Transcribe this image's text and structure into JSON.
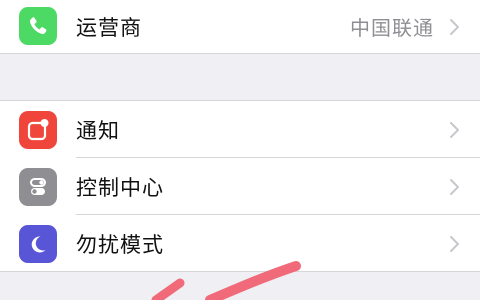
{
  "carrier_row": {
    "label": "运营商",
    "value": "中国联通",
    "icon": "phone-icon",
    "icon_color": "#4cd964"
  },
  "settings_rows": [
    {
      "label": "通知",
      "icon": "notifications-icon",
      "icon_color": "#f0453a"
    },
    {
      "label": "控制中心",
      "icon": "control-center-icon",
      "icon_color": "#8e8e93"
    },
    {
      "label": "勿扰模式",
      "icon": "do-not-disturb-moon-icon",
      "icon_color": "#5856d6"
    }
  ],
  "colors": {
    "background": "#efeff4",
    "chevron": "#c7c7cc",
    "annotation": "#f06a7a"
  }
}
